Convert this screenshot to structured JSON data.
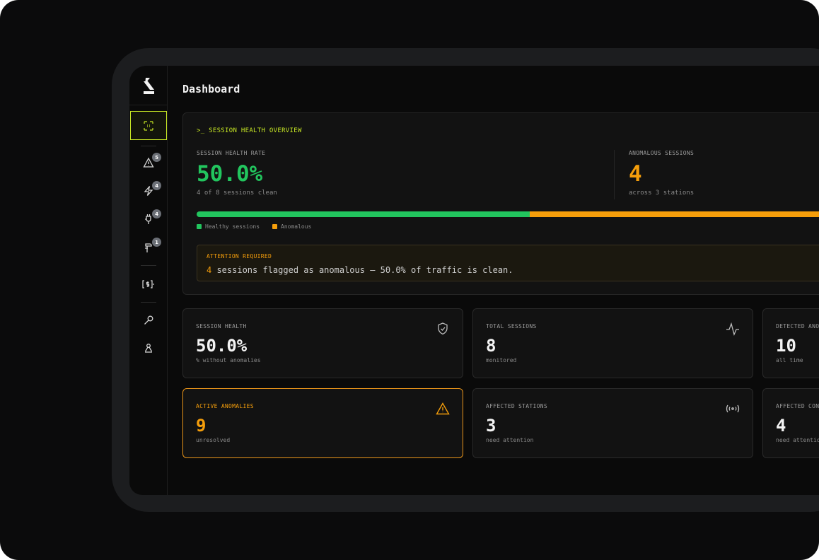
{
  "page": {
    "title": "Dashboard"
  },
  "sidebar": {
    "items": [
      {
        "name": "dashboard",
        "icon": "dashboard-grid-icon",
        "active": true
      },
      {
        "name": "alerts",
        "icon": "warning-icon",
        "badge": "5"
      },
      {
        "name": "events",
        "icon": "lightning-icon",
        "badge": "4"
      },
      {
        "name": "chargers",
        "icon": "plug-icon",
        "badge": "4"
      },
      {
        "name": "users",
        "icon": "user-icon",
        "badge": "1"
      },
      {
        "name": "billing",
        "icon": "dollar-bracket-icon"
      },
      {
        "name": "tools",
        "icon": "wrench-icon"
      },
      {
        "name": "webhooks",
        "icon": "webhook-icon"
      }
    ]
  },
  "overview": {
    "heading": ">_ SESSION HEALTH OVERVIEW",
    "health_label": "SESSION HEALTH RATE",
    "health_value": "50.0%",
    "health_sub": "4 of 8 sessions clean",
    "anom_label": "ANOMALOUS SESSIONS",
    "anom_value": "4",
    "anom_sub": "across 3 stations",
    "healthy_fraction": 0.5,
    "legend_healthy": "Healthy sessions",
    "legend_anomalous": "Anomalous",
    "attention_title": "ATTENTION REQUIRED",
    "attention_count": "4",
    "attention_text": " sessions flagged as anomalous — 50.0% of traffic is clean."
  },
  "cards": [
    {
      "label": "SESSION HEALTH",
      "value": "50.0%",
      "sub": "% without anomalies",
      "icon": "shield-check-icon"
    },
    {
      "label": "TOTAL SESSIONS",
      "value": "8",
      "sub": "monitored",
      "icon": "activity-icon"
    },
    {
      "label": "DETECTED ANOMALIES",
      "value": "10",
      "sub": "all time",
      "icon": "search-icon"
    },
    {
      "label": "ACTIVE ANOMALIES",
      "value": "9",
      "sub": "unresolved",
      "icon": "warning-icon",
      "warn": true
    },
    {
      "label": "AFFECTED STATIONS",
      "value": "3",
      "sub": "need attention",
      "icon": "broadcast-icon"
    },
    {
      "label": "AFFECTED CONNECTORS",
      "value": "4",
      "sub": "need attention",
      "icon": "plug-icon"
    }
  ],
  "colors": {
    "accent": "#c6e624",
    "healthy": "#22c55e",
    "anomalous": "#f59e0b",
    "badge": "#6b6f76"
  }
}
